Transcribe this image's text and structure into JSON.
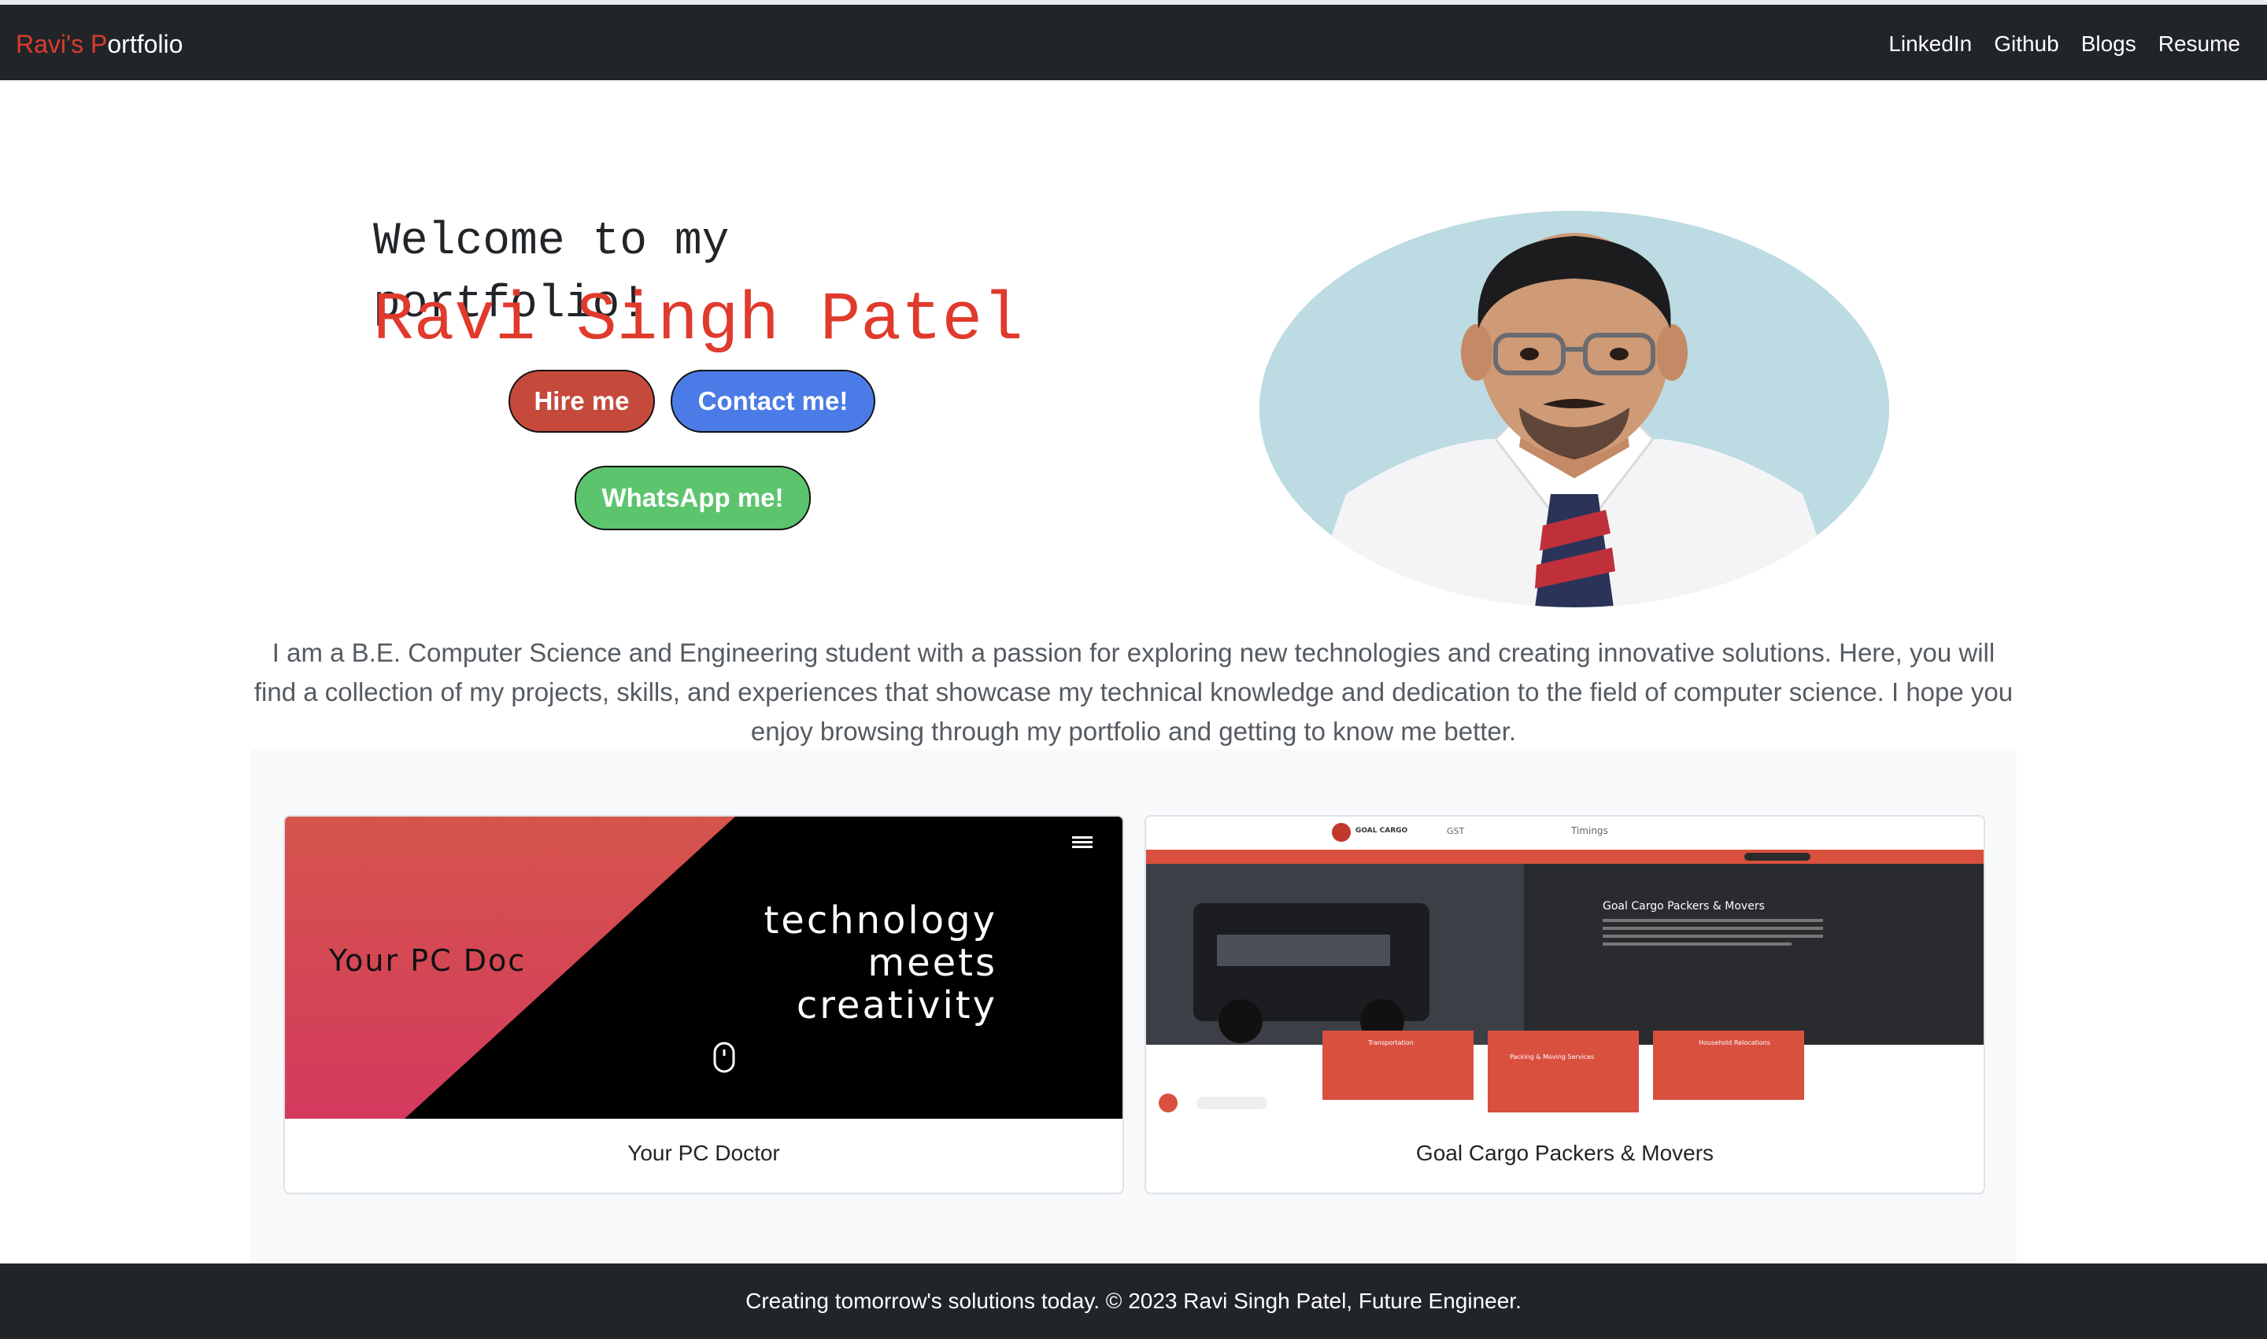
{
  "navbar": {
    "brand_part1": "Ravi's P",
    "brand_part2": "ortfolio",
    "links": [
      "LinkedIn",
      "Github",
      "Blogs",
      "Resume"
    ]
  },
  "hero": {
    "welcome": "Welcome to my portfolio!",
    "name": "Ravi Singh Patel",
    "hire_button": "Hire me",
    "contact_button": "Contact me!",
    "whatsapp_button": "WhatsApp me!"
  },
  "intro": "I am a B.E. Computer Science and Engineering student with a passion for exploring new technologies and creating innovative solutions. Here, you will find a collection of my projects, skills, and experiences that showcase my technical knowledge and dedication to the field of computer science. I hope you enjoy browsing through my portfolio and getting to know me better.",
  "projects": [
    {
      "title": "Your PC Doctor",
      "screenshot": {
        "left_text": "Your PC Doc",
        "line1": "technology",
        "line2": "meets",
        "line3": "creativity"
      }
    },
    {
      "title": "Goal Cargo Packers & Movers",
      "screenshot": {
        "logo": "GOAL CARGO",
        "gst": "GST",
        "timings": "Timings",
        "heading": "Goal Cargo Packers & Movers",
        "service1": "Transportation",
        "service2": "Packing & Moving Services",
        "service3": "Household Relocations"
      }
    }
  ],
  "footer": "Creating tomorrow's solutions today. © 2023 Ravi Singh Patel, Future Engineer.",
  "colors": {
    "navbar_bg": "#212529",
    "accent_red": "#e03a2c",
    "hire_btn": "#c54a3c",
    "contact_btn": "#4b7be6",
    "whatsapp_btn": "#5dc46e"
  }
}
